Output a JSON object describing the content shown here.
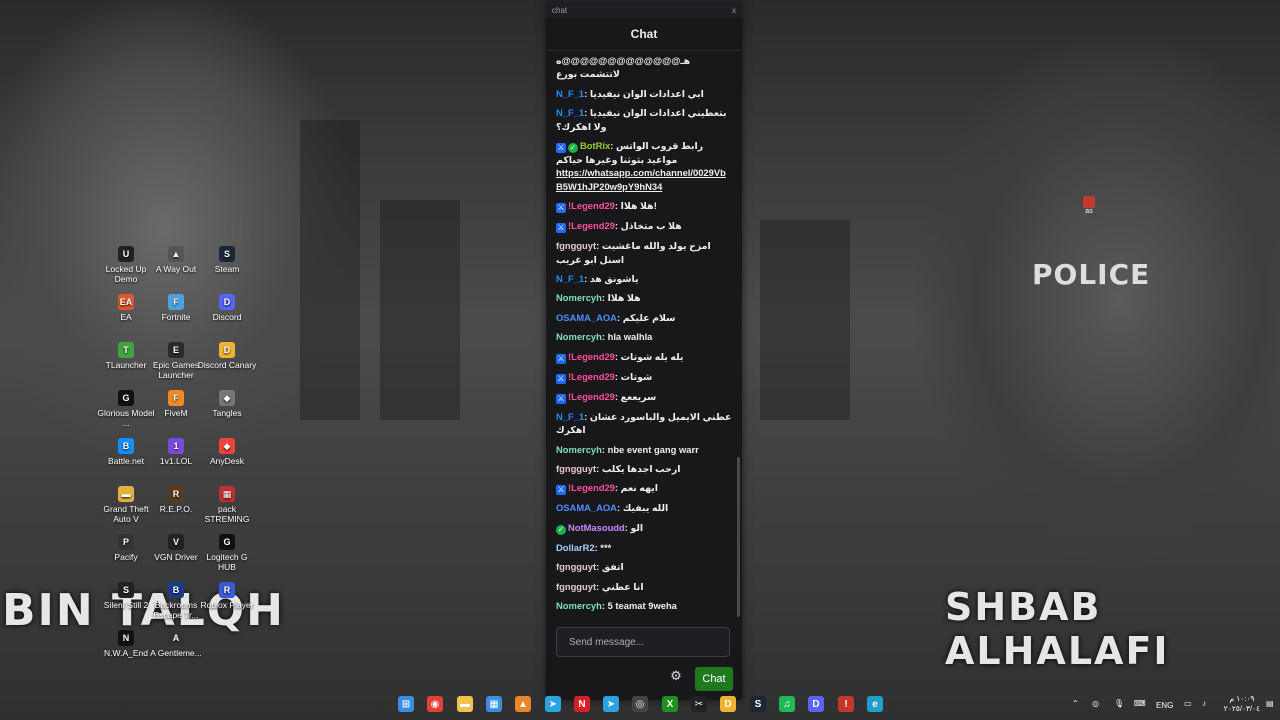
{
  "desktop": {
    "icons": [
      {
        "label": "Locked Up Demo",
        "color": "#222",
        "glyph": "U"
      },
      {
        "label": "A Way Out",
        "color": "#555",
        "glyph": "▲"
      },
      {
        "label": "Steam",
        "color": "#1b2838",
        "glyph": "S"
      },
      {
        "label": "EA",
        "color": "#e4572e",
        "glyph": "EA"
      },
      {
        "label": "Fortnite",
        "color": "#4aa3df",
        "glyph": "F"
      },
      {
        "label": "Discord",
        "color": "#5865f2",
        "glyph": "D"
      },
      {
        "label": "TLauncher",
        "color": "#3fa33f",
        "glyph": "T"
      },
      {
        "label": "Epic Games Launcher",
        "color": "#2a2a2a",
        "glyph": "E"
      },
      {
        "label": "Discord Canary",
        "color": "#f0b232",
        "glyph": "D"
      },
      {
        "label": "Glorious Model ...",
        "color": "#111",
        "glyph": "G"
      },
      {
        "label": "FiveM",
        "color": "#f08a24",
        "glyph": "F"
      },
      {
        "label": "Tangles",
        "color": "#777",
        "glyph": "◆"
      },
      {
        "label": "Battle.net",
        "color": "#148eff",
        "glyph": "B"
      },
      {
        "label": "1v1.LOL",
        "color": "#7a4bd8",
        "glyph": "1"
      },
      {
        "label": "AnyDesk",
        "color": "#ef443b",
        "glyph": "◆"
      },
      {
        "label": "Grand Theft Auto V",
        "color": "#e3b341",
        "glyph": "▬"
      },
      {
        "label": "R.E.P.O.",
        "color": "#5a3a1a",
        "glyph": "R"
      },
      {
        "label": "pack STREMING",
        "color": "#c03030",
        "glyph": "▦"
      },
      {
        "label": "Pacify",
        "color": "#333",
        "glyph": "P"
      },
      {
        "label": "VGN Driver",
        "color": "#222",
        "glyph": "V"
      },
      {
        "label": "Logitech G HUB",
        "color": "#111",
        "glyph": "G"
      },
      {
        "label": "Silent Still 2",
        "color": "#222",
        "glyph": "S"
      },
      {
        "label": "Backrooms Escape Tr...",
        "color": "#1a3a8a",
        "glyph": "B"
      },
      {
        "label": "Roblox Player",
        "color": "#3a5bd8",
        "glyph": "R"
      },
      {
        "label": "N.W.A_End",
        "color": "#111",
        "glyph": "N"
      },
      {
        "label": "A Gentleme...",
        "color": "#333",
        "glyph": "A"
      }
    ],
    "wallpaper_left_text": "BIN TALQH",
    "wallpaper_right_text": "SHBAB ALHALAFI",
    "wallpaper_police_text": "POLICE",
    "small_icon_label": "as"
  },
  "chat": {
    "window_title": "chat",
    "close_label": "x",
    "header": "Chat",
    "input_placeholder": "Send message...",
    "send_button": "Chat",
    "messages": [
      {
        "user": "",
        "user_color": "#efeff1",
        "text": "هـ@@@@@@@@@@@@@ه لاتتشمت بورع",
        "badges": []
      },
      {
        "user": "N_F_1",
        "user_color": "#1e90ff",
        "text": "ابي اعدادات الوان نيفيديا",
        "badges": []
      },
      {
        "user": "N_F_1",
        "user_color": "#1e90ff",
        "text": "بتعطيني اعدادات الوان نيفيديا ولا اهكرك؟",
        "badges": []
      },
      {
        "user": "BotRix",
        "user_color": "#9acd32",
        "text": "رابط قروب الواتس مواعيد بثوثنا وغيرها حياكم",
        "link": "https://whatsapp.com/channel/0029VbB5W1hJP20w9pY9hN34",
        "badges": [
          "mod",
          "ver"
        ]
      },
      {
        "user": "!Legend29",
        "user_color": "#ff4fa0",
        "text": "هلا هلاا!",
        "badges": [
          "mod"
        ]
      },
      {
        "user": "!Legend29",
        "user_color": "#ff4fa0",
        "text": "هلا ب متخاذل",
        "badges": [
          "mod"
        ]
      },
      {
        "user": "fgngguyt",
        "user_color": "#e8c7d4",
        "text": "امزح يولد والله ماغشيت اسنل ابو غريب",
        "badges": []
      },
      {
        "user": "N_F_1",
        "user_color": "#1e90ff",
        "text": "ياشونق هد",
        "badges": []
      },
      {
        "user": "Nomercyh",
        "user_color": "#7fe0c0",
        "text": "هلا هلاا",
        "badges": []
      },
      {
        "user": "OSAMA_AOA",
        "user_color": "#4f8cff",
        "text": "سلام عليكم",
        "badges": []
      },
      {
        "user": "Nomercyh",
        "user_color": "#7fe0c0",
        "text": "hla walhla",
        "badges": []
      },
      {
        "user": "!Legend29",
        "user_color": "#ff4fa0",
        "text": "يله يله شوتات",
        "badges": [
          "mod"
        ]
      },
      {
        "user": "!Legend29",
        "user_color": "#ff4fa0",
        "text": "شوتات",
        "badges": [
          "mod"
        ]
      },
      {
        "user": "!Legend29",
        "user_color": "#ff4fa0",
        "text": "سريععع",
        "badges": [
          "mod"
        ]
      },
      {
        "user": "N_F_1",
        "user_color": "#1e90ff",
        "text": "عطني الايميل والباسورد عشان اهكرك",
        "badges": []
      },
      {
        "user": "Nomercyh",
        "user_color": "#7fe0c0",
        "text": "nbe event gang warr",
        "badges": []
      },
      {
        "user": "fgngguyt",
        "user_color": "#e8c7d4",
        "text": "ارحب اجدها يكلب",
        "badges": []
      },
      {
        "user": "!Legend29",
        "user_color": "#ff4fa0",
        "text": "ايهه نعم",
        "badges": [
          "mod"
        ]
      },
      {
        "user": "OSAMA_AOA",
        "user_color": "#4f8cff",
        "text": "الله يبفيك",
        "badges": []
      },
      {
        "user": "NotMasoudd",
        "user_color": "#c78bff",
        "text": "الو",
        "badges": [
          "ver"
        ]
      },
      {
        "user": "DollarR2",
        "user_color": "#a9d0ff",
        "text": "***",
        "badges": []
      },
      {
        "user": "fgngguyt",
        "user_color": "#e8c7d4",
        "text": "اتفق",
        "badges": []
      },
      {
        "user": "fgngguyt",
        "user_color": "#e8c7d4",
        "text": "انا عطني",
        "badges": []
      },
      {
        "user": "Nomercyh",
        "user_color": "#7fe0c0",
        "text": "5 teamat 9weha",
        "badges": []
      }
    ]
  },
  "taskbar": {
    "apps": [
      {
        "name": "windows-start-icon",
        "color": "#3a8ee6",
        "glyph": "⊞"
      },
      {
        "name": "chrome-icon",
        "color": "#e34133",
        "glyph": "◉"
      },
      {
        "name": "file-explorer-icon",
        "color": "#f2c14e",
        "glyph": "▬"
      },
      {
        "name": "store-icon",
        "color": "#3a8ee6",
        "glyph": "▦"
      },
      {
        "name": "app-orange-icon",
        "color": "#e8862a",
        "glyph": "▲"
      },
      {
        "name": "telegram-icon",
        "color": "#2aa3e0",
        "glyph": "➤"
      },
      {
        "name": "netflix-icon",
        "color": "#d81f26",
        "glyph": "N"
      },
      {
        "name": "telegram-2-icon",
        "color": "#2aa3e0",
        "glyph": "➤"
      },
      {
        "name": "obs-icon",
        "color": "#444",
        "glyph": "◎"
      },
      {
        "name": "xbox-icon",
        "color": "#1f8f1f",
        "glyph": "X"
      },
      {
        "name": "capcut-icon",
        "color": "#222",
        "glyph": "✂"
      },
      {
        "name": "discord-canary-icon",
        "color": "#f0b232",
        "glyph": "D"
      },
      {
        "name": "steam-icon",
        "color": "#1b2838",
        "glyph": "S"
      },
      {
        "name": "spotify-icon",
        "color": "#1db954",
        "glyph": "♫"
      },
      {
        "name": "discord-icon",
        "color": "#5865f2",
        "glyph": "D"
      },
      {
        "name": "app-alert-icon",
        "color": "#c0392b",
        "glyph": "!"
      },
      {
        "name": "edge-icon",
        "color": "#1fa0c8",
        "glyph": "e"
      }
    ],
    "language": "ENG",
    "time": "١٠:٠٩ م",
    "date": "٢٠٢٥/٠٣/٠٤"
  }
}
